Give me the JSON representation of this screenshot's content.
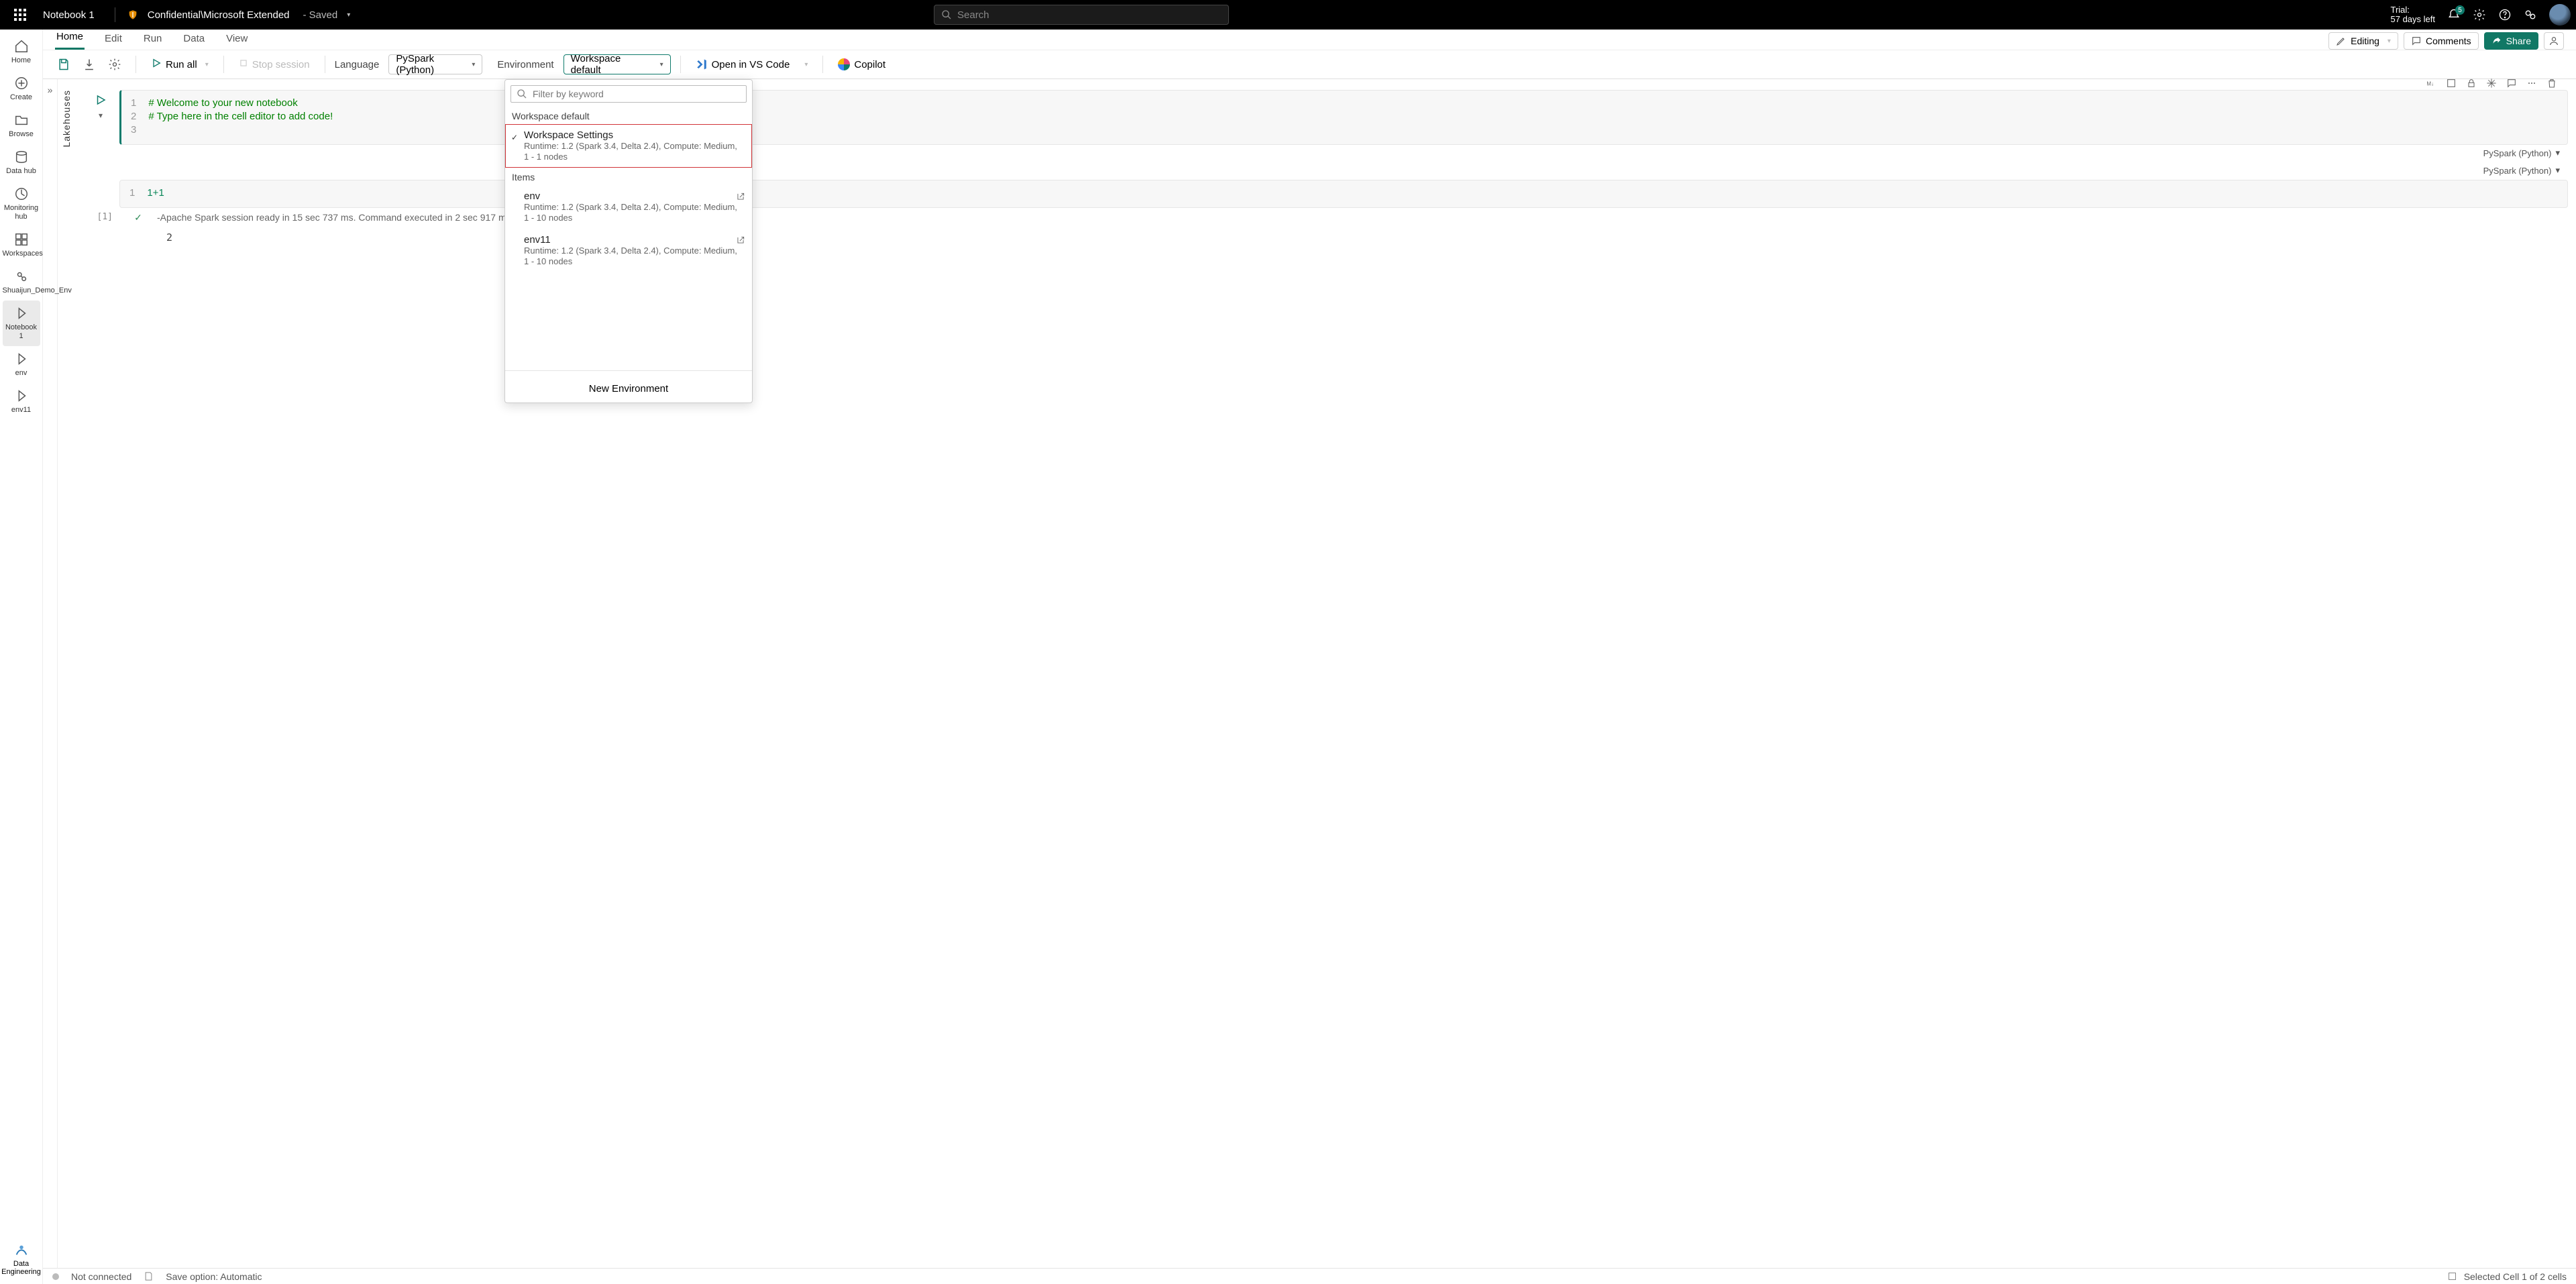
{
  "topbar": {
    "notebook_name": "Notebook 1",
    "sensitivity_label": "Confidential\\Microsoft Extended",
    "saved_label": "- Saved",
    "search_placeholder": "Search",
    "trial_line1": "Trial:",
    "trial_line2": "57 days left",
    "notif_badge": "5"
  },
  "menubar": {
    "tabs": [
      "Home",
      "Edit",
      "Run",
      "Data",
      "View"
    ],
    "editing_label": "Editing",
    "comments_label": "Comments",
    "share_label": "Share"
  },
  "toolbar": {
    "run_all_label": "Run all",
    "stop_session_label": "Stop session",
    "language_label": "Language",
    "language_value": "PySpark (Python)",
    "environment_label": "Environment",
    "environment_value": "Workspace default",
    "open_vscode_label": "Open in VS Code",
    "copilot_label": "Copilot"
  },
  "leftrail": {
    "items": [
      {
        "label": "Home"
      },
      {
        "label": "Create"
      },
      {
        "label": "Browse"
      },
      {
        "label": "Data hub"
      },
      {
        "label": "Monitoring hub"
      },
      {
        "label": "Workspaces"
      },
      {
        "label": "Shuaijun_Demo_Env"
      },
      {
        "label": "Notebook 1"
      },
      {
        "label": "env"
      },
      {
        "label": "env11"
      }
    ],
    "bottom_label": "Data Engineering"
  },
  "lakehouses_label": "Lakehouses",
  "cells": [
    {
      "lines": [
        "# Welcome to your new notebook",
        "# Type here in the cell editor to add code!",
        ""
      ],
      "lang": "PySpark (Python)"
    },
    {
      "lines": [
        "1+1"
      ],
      "exec_count": "[1]",
      "status_text": "-Apache Spark session ready in 15 sec 737 ms. Command executed in 2 sec 917 ms by Shuaijun Ye on 4:59:0",
      "output": "2",
      "lang": "PySpark (Python)"
    }
  ],
  "env_panel": {
    "filter_placeholder": "Filter by keyword",
    "group1_label": "Workspace default",
    "workspace_item": {
      "title": "Workspace Settings",
      "sub": "Runtime: 1.2 (Spark 3.4, Delta 2.4), Compute: Medium, 1 - 1 nodes"
    },
    "group2_label": "Items",
    "items": [
      {
        "title": "env",
        "sub": "Runtime: 1.2 (Spark 3.4, Delta 2.4), Compute: Medium, 1 - 10 nodes"
      },
      {
        "title": "env11",
        "sub": "Runtime: 1.2 (Spark 3.4, Delta 2.4), Compute: Medium, 1 - 10 nodes"
      }
    ],
    "new_label": "New Environment"
  },
  "statusbar": {
    "conn_label": "Not connected",
    "save_label": "Save option: Automatic",
    "selection_label": "Selected Cell 1 of 2 cells"
  }
}
